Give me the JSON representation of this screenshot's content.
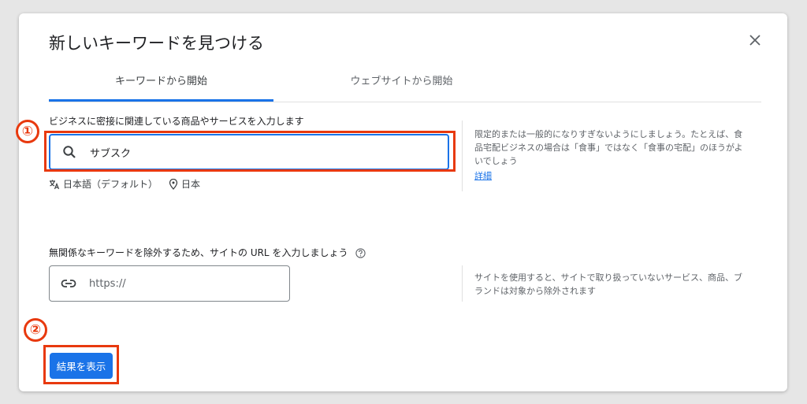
{
  "dialog": {
    "title": "新しいキーワードを見つける"
  },
  "tabs": [
    {
      "label": "キーワードから開始",
      "active": true
    },
    {
      "label": "ウェブサイトから開始",
      "active": false
    }
  ],
  "keyword_section": {
    "label": "ビジネスに密接に関連している商品やサービスを入力します",
    "input_value": "サブスク",
    "language": "日本語（デフォルト）",
    "location": "日本",
    "help_text": "限定的または一般的になりすぎないようにしましょう。たとえば、食品宅配ビジネスの場合は「食事」ではなく「食事の宅配」のほうがよいでしょう",
    "help_link": "詳細"
  },
  "site_section": {
    "label": "無関係なキーワードを除外するため、サイトの URL を入力しましょう",
    "input_placeholder": "https://",
    "help_text": "サイトを使用すると、サイトで取り扱っていないサービス、商品、ブランドは対象から除外されます"
  },
  "actions": {
    "submit_label": "結果を表示"
  },
  "annotations": {
    "badge_1": "①",
    "badge_2": "②",
    "color": "#e8390e"
  },
  "colors": {
    "accent": "#1a73e8"
  }
}
